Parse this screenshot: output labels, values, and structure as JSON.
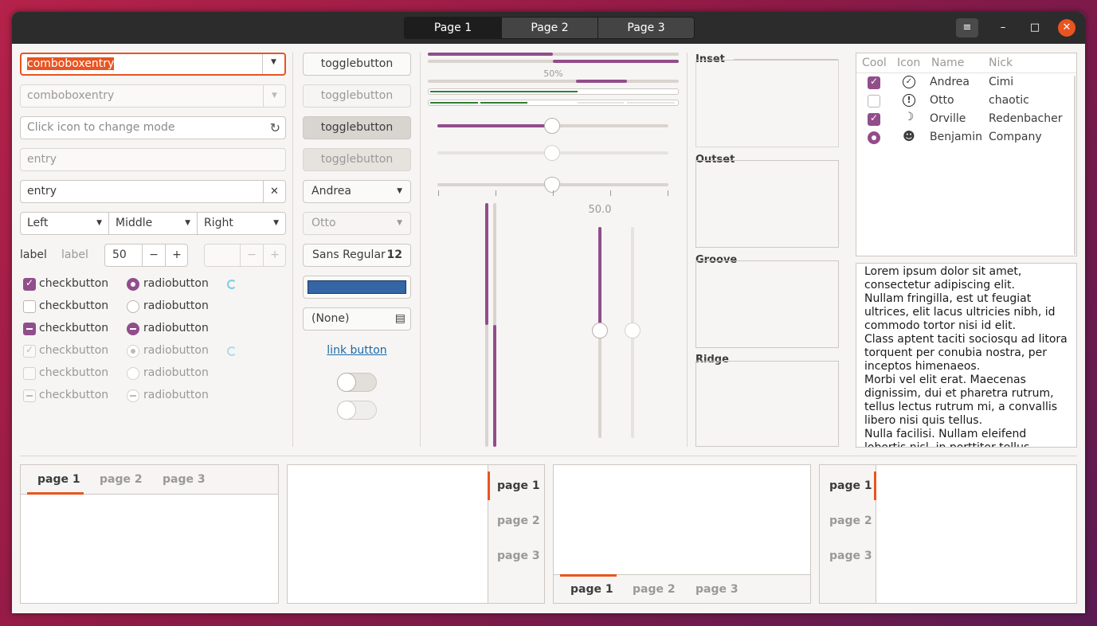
{
  "window": {
    "switcher": [
      "Page 1",
      "Page 2",
      "Page 3"
    ],
    "buttons": {
      "menu": "≡",
      "minimize": "–",
      "maximize": "□",
      "close": "✕"
    }
  },
  "col1": {
    "combo_focused": "comboboxentry",
    "combo_disabled": "comboboxentry",
    "search_placeholder": "Click icon to change mode",
    "entry_disabled": "entry",
    "entry_value": "entry",
    "segments": [
      "Left",
      "Middle",
      "Right"
    ],
    "label1": "label",
    "label2": "label",
    "spin_value": "50",
    "checks": [
      {
        "label": "checkbutton",
        "state": "on",
        "disabled": false
      },
      {
        "label": "checkbutton",
        "state": "off",
        "disabled": false
      },
      {
        "label": "checkbutton",
        "state": "mixed",
        "disabled": false
      },
      {
        "label": "checkbutton",
        "state": "on",
        "disabled": true
      },
      {
        "label": "checkbutton",
        "state": "off",
        "disabled": true
      },
      {
        "label": "checkbutton",
        "state": "mixed",
        "disabled": true
      }
    ],
    "radios": [
      {
        "label": "radiobutton",
        "state": "on",
        "disabled": false
      },
      {
        "label": "radiobutton",
        "state": "off",
        "disabled": false
      },
      {
        "label": "radiobutton",
        "state": "mixed",
        "disabled": false
      },
      {
        "label": "radiobutton",
        "state": "on",
        "disabled": true
      },
      {
        "label": "radiobutton",
        "state": "off",
        "disabled": true
      },
      {
        "label": "radiobutton",
        "state": "mixed",
        "disabled": true
      }
    ]
  },
  "col2": {
    "toggles": [
      "togglebutton",
      "togglebutton",
      "togglebutton",
      "togglebutton"
    ],
    "combo1": "Andrea",
    "combo2": "Otto",
    "font_name": "Sans Regular",
    "font_size": "12",
    "color_swatch": "#3465a4",
    "file_chooser": "(None)",
    "link": "link button",
    "switch1_on": false,
    "switch2_on": false
  },
  "col3": {
    "progress_label": "50%",
    "progress_fraction": 0.5,
    "scale_value_label": "50.0",
    "scale_fraction": 0.5
  },
  "frames": [
    "Inset",
    "Outset",
    "Groove",
    "Ridge"
  ],
  "treeview": {
    "headers": [
      "Cool",
      "Icon",
      "Name",
      "Nick"
    ],
    "rows": [
      {
        "cool": "check-on",
        "icon": "check-circle-icon",
        "glyph": "✓",
        "name": "Andrea",
        "nick": "Cimi"
      },
      {
        "cool": "check-off",
        "icon": "exclamation-circle-icon",
        "glyph": "!",
        "name": "Otto",
        "nick": "chaotic"
      },
      {
        "cool": "check-on",
        "icon": "weather-night-icon",
        "glyph": "☽",
        "name": "Orville",
        "nick": "Redenbacher"
      },
      {
        "cool": "radio-on",
        "icon": "user-icon",
        "glyph": "☻",
        "name": "Benjamin",
        "nick": "Company"
      }
    ]
  },
  "textview": [
    "Lorem ipsum dolor sit amet, consectetur adipiscing elit.",
    "Nullam fringilla, est ut feugiat ultrices, elit lacus ultricies nibh, id commodo tortor nisi id elit.",
    "Class aptent taciti sociosqu ad litora torquent per conubia nostra, per inceptos himenaeos.",
    "Morbi vel elit erat. Maecenas dignissim, dui et pharetra rutrum, tellus lectus rutrum mi, a convallis libero nisi quis tellus.",
    "Nulla facilisi. Nullam eleifend lobortis nisl, in porttitor tellus malesuada"
  ],
  "notebooks": {
    "top": [
      "page 1",
      "page 2",
      "page 3"
    ],
    "right": [
      "page 1",
      "page 2",
      "page 3"
    ],
    "bottom": [
      "page 1",
      "page 2",
      "page 3"
    ],
    "left": [
      "page 1",
      "page 2",
      "page 3"
    ]
  },
  "colors": {
    "accent": "#e95420",
    "purple": "#924d8b",
    "green": "#2e7d32"
  }
}
